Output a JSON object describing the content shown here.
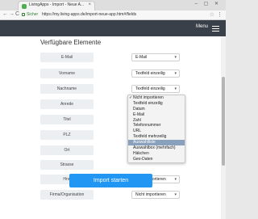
{
  "browser": {
    "tab_title": "LivingApps - Import - Neue A...",
    "tab_close": "×",
    "window_controls": "– ▢ ✕",
    "nav_back": "←",
    "nav_forward": "→",
    "nav_reload": "C",
    "secure_label": "Sicher",
    "url": "https://my.living-apps.de/import-neue-app.htm#/fields",
    "star_icon": "☆",
    "kebab_icon": "⋮"
  },
  "appbar": {
    "menu_label": "Menu"
  },
  "section_title": "Verfügbare Elemente",
  "fields": [
    {
      "label": "E-Mail",
      "select": "E-Mail"
    },
    {
      "label": "Vorname",
      "select": "Textfeld einzeilig"
    },
    {
      "label": "Nachname",
      "select": "Textfeld einzeilig"
    },
    {
      "label": "Anrede",
      "select": ""
    },
    {
      "label": "Titel",
      "select": ""
    },
    {
      "label": "PLZ",
      "select": ""
    },
    {
      "label": "Ort",
      "select": ""
    },
    {
      "label": "Strasse",
      "select": ""
    },
    {
      "label": "Hnn",
      "select": "Nicht importieren"
    },
    {
      "label": "Firma/Organisation",
      "select": "Nicht importieren"
    }
  ],
  "dropdown_options": [
    "Nicht importieren",
    "Textfeld einzeilig",
    "Datum",
    "E-Mail",
    "Zahl",
    "Telefonnummer",
    "URL",
    "Textfeld mehrzeilig",
    "Auswahlliste",
    "Auswahlbox (mehrfach)",
    "Häkchen",
    "Geo-Daten"
  ],
  "dropdown_checked_index": 0,
  "dropdown_highlight_index": 8,
  "import_button": "Import starten",
  "caret_icon": "▾"
}
